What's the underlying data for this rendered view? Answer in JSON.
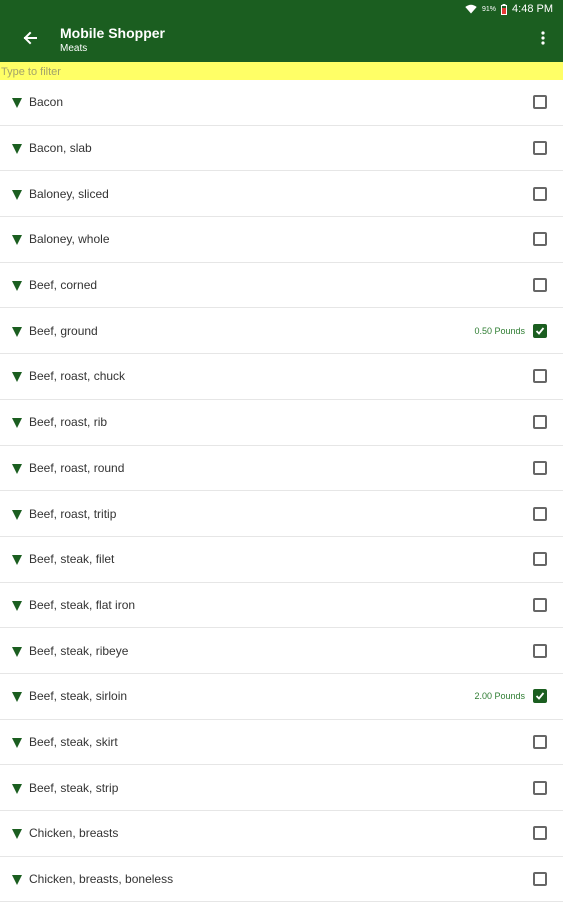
{
  "status_bar": {
    "battery_percent": "91%",
    "time": "4:48 PM"
  },
  "app_bar": {
    "title": "Mobile Shopper",
    "subtitle": "Meats"
  },
  "filter": {
    "placeholder": "Type to filter",
    "value": ""
  },
  "items": [
    {
      "name": "Bacon",
      "quantity": "",
      "checked": false
    },
    {
      "name": "Bacon, slab",
      "quantity": "",
      "checked": false
    },
    {
      "name": "Baloney, sliced",
      "quantity": "",
      "checked": false
    },
    {
      "name": "Baloney, whole",
      "quantity": "",
      "checked": false
    },
    {
      "name": "Beef, corned",
      "quantity": "",
      "checked": false
    },
    {
      "name": "Beef, ground",
      "quantity": "0.50 Pounds",
      "checked": true
    },
    {
      "name": "Beef, roast, chuck",
      "quantity": "",
      "checked": false
    },
    {
      "name": "Beef, roast, rib",
      "quantity": "",
      "checked": false
    },
    {
      "name": "Beef, roast, round",
      "quantity": "",
      "checked": false
    },
    {
      "name": "Beef, roast, tritip",
      "quantity": "",
      "checked": false
    },
    {
      "name": "Beef, steak, filet",
      "quantity": "",
      "checked": false
    },
    {
      "name": "Beef, steak, flat iron",
      "quantity": "",
      "checked": false
    },
    {
      "name": "Beef, steak, ribeye",
      "quantity": "",
      "checked": false
    },
    {
      "name": "Beef, steak, sirloin",
      "quantity": "2.00 Pounds",
      "checked": true
    },
    {
      "name": "Beef, steak, skirt",
      "quantity": "",
      "checked": false
    },
    {
      "name": "Beef, steak, strip",
      "quantity": "",
      "checked": false
    },
    {
      "name": "Chicken, breasts",
      "quantity": "",
      "checked": false
    },
    {
      "name": "Chicken, breasts, boneless",
      "quantity": "",
      "checked": false
    }
  ],
  "icons": {
    "back": "arrow-left-icon",
    "menu": "more-vert-icon",
    "expand": "triangle-down-icon",
    "wifi": "wifi-icon",
    "battery": "battery-icon"
  },
  "colors": {
    "primary": "#1b5e20",
    "filter_bg": "#ffff66",
    "quantity_text": "#2e7d32"
  }
}
